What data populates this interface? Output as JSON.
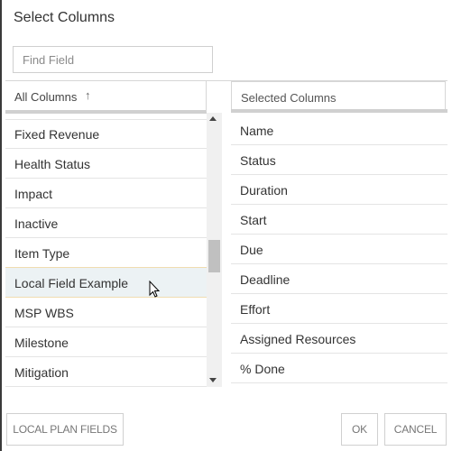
{
  "dialog": {
    "title": "Select Columns",
    "search": {
      "placeholder": "Find Field",
      "value": ""
    }
  },
  "all_columns": {
    "header": "All Columns",
    "sort_icon": "sort-ascending-icon",
    "items": [
      {
        "label": "Fixed Revenue"
      },
      {
        "label": "Health Status"
      },
      {
        "label": "Impact"
      },
      {
        "label": "Inactive"
      },
      {
        "label": "Item Type"
      },
      {
        "label": "Local Field Example",
        "hovered": true
      },
      {
        "label": "MSP WBS"
      },
      {
        "label": "Milestone"
      },
      {
        "label": "Mitigation"
      }
    ]
  },
  "selected_columns": {
    "header": "Selected Columns",
    "items": [
      {
        "label": "Name"
      },
      {
        "label": "Status"
      },
      {
        "label": "Duration"
      },
      {
        "label": "Start"
      },
      {
        "label": "Due"
      },
      {
        "label": "Deadline"
      },
      {
        "label": "Effort"
      },
      {
        "label": "Assigned Resources"
      },
      {
        "label": "% Done"
      }
    ]
  },
  "buttons": {
    "local_plan_fields": "LOCAL PLAN FIELDS",
    "ok": "OK",
    "cancel": "CANCEL"
  }
}
